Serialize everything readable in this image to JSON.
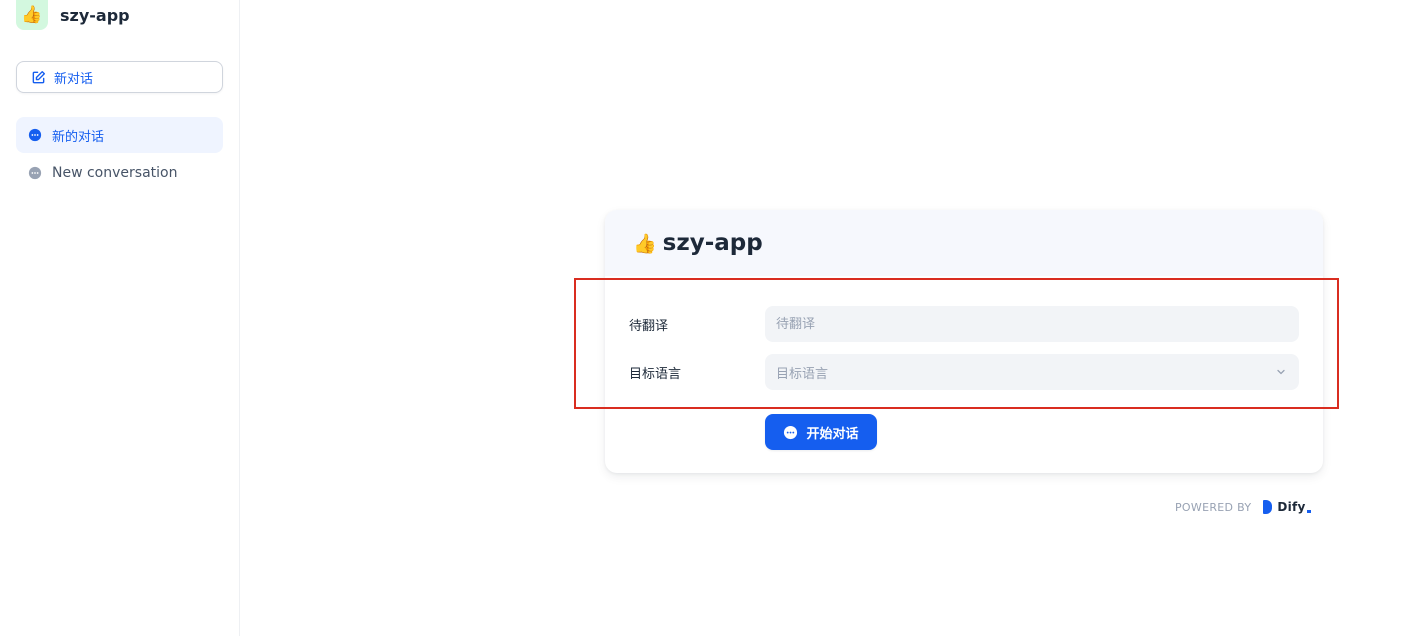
{
  "sidebar": {
    "app_name": "szy-app",
    "app_icon": "👍",
    "new_chat_label": "新对话",
    "conversations": [
      {
        "label": "新的对话",
        "active": true
      },
      {
        "label": "New conversation",
        "active": false
      }
    ]
  },
  "card": {
    "icon": "👍",
    "title": "szy-app",
    "fields": [
      {
        "label": "待翻译",
        "placeholder": "待翻译",
        "type": "text"
      },
      {
        "label": "目标语言",
        "placeholder": "目标语言",
        "type": "select"
      }
    ],
    "start_label": "开始对话"
  },
  "footer": {
    "powered_by": "POWERED BY",
    "brand": "Dify"
  },
  "colors": {
    "accent": "#155eef",
    "highlight": "#d92d20"
  }
}
